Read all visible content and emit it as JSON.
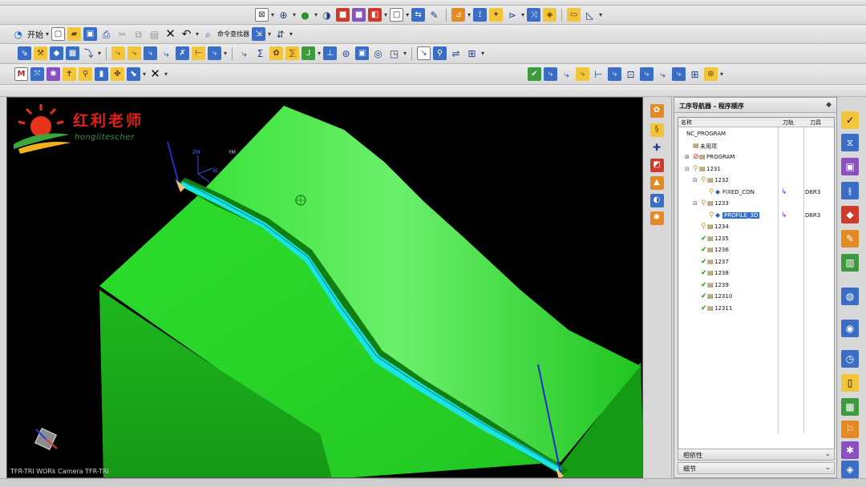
{
  "toolbar": {
    "start_label": "开始",
    "command_finder_label": "命令查找器"
  },
  "viewport": {
    "logo_text": "红利老师",
    "logo_subtext": "honglitescher",
    "status_text": "TFR-TRI WORk Camera TFR-TRI",
    "wcs_labels": [
      "ZM",
      "YM",
      "XC"
    ],
    "colors": {
      "background": "#000000",
      "part": "#1fd81f",
      "toolpath": "#18e6e6"
    }
  },
  "navigator": {
    "title": "工序导航器 - 程序顺序",
    "columns": {
      "name": "名称",
      "tool_change": "刀轨",
      "tool": "刀具"
    },
    "rows": [
      {
        "label": "NC_PROGRAM",
        "expander": "",
        "icon": "",
        "status": "",
        "tool_change": "",
        "tool": "",
        "selected": false
      },
      {
        "label": "未用项",
        "expander": "",
        "icon": "folder",
        "status": "",
        "tool_change": "",
        "tool": "",
        "selected": false
      },
      {
        "label": "PROGRAM",
        "expander": "+",
        "icon": "folder",
        "status": "no",
        "tool_change": "",
        "tool": "",
        "selected": false
      },
      {
        "label": "1231",
        "expander": "-",
        "icon": "folder",
        "status": "key",
        "tool_change": "",
        "tool": "",
        "selected": false
      },
      {
        "label": "1232",
        "expander": "-",
        "icon": "folder",
        "status": "key",
        "tool_change": "",
        "tool": "",
        "selected": false
      },
      {
        "label": "FIXED_CON",
        "expander": "",
        "icon": "op",
        "status": "key",
        "tool_change": "↳",
        "tool": "D6R3",
        "selected": false
      },
      {
        "label": "1233",
        "expander": "-",
        "icon": "folder",
        "status": "key",
        "tool_change": "",
        "tool": "",
        "selected": false
      },
      {
        "label": "PROFILE_3D",
        "expander": "",
        "icon": "op",
        "status": "key",
        "tool_change": "↳",
        "tool": "D6R3",
        "selected": true
      },
      {
        "label": "1234",
        "expander": "",
        "icon": "folder",
        "status": "key",
        "tool_change": "",
        "tool": "",
        "selected": false
      },
      {
        "label": "1235",
        "expander": "",
        "icon": "folder",
        "status": "check",
        "tool_change": "",
        "tool": "",
        "selected": false
      },
      {
        "label": "1236",
        "expander": "",
        "icon": "folder",
        "status": "check",
        "tool_change": "",
        "tool": "",
        "selected": false
      },
      {
        "label": "1237",
        "expander": "",
        "icon": "folder",
        "status": "check",
        "tool_change": "",
        "tool": "",
        "selected": false
      },
      {
        "label": "1238",
        "expander": "",
        "icon": "folder",
        "status": "check",
        "tool_change": "",
        "tool": "",
        "selected": false
      },
      {
        "label": "1239",
        "expander": "",
        "icon": "folder",
        "status": "check",
        "tool_change": "",
        "tool": "",
        "selected": false
      },
      {
        "label": "12310",
        "expander": "",
        "icon": "folder",
        "status": "check",
        "tool_change": "",
        "tool": "",
        "selected": false
      },
      {
        "label": "12311",
        "expander": "",
        "icon": "folder",
        "status": "check",
        "tool_change": "",
        "tool": "",
        "selected": false
      }
    ],
    "section_dependencies": "相依性",
    "section_details": "细节"
  }
}
